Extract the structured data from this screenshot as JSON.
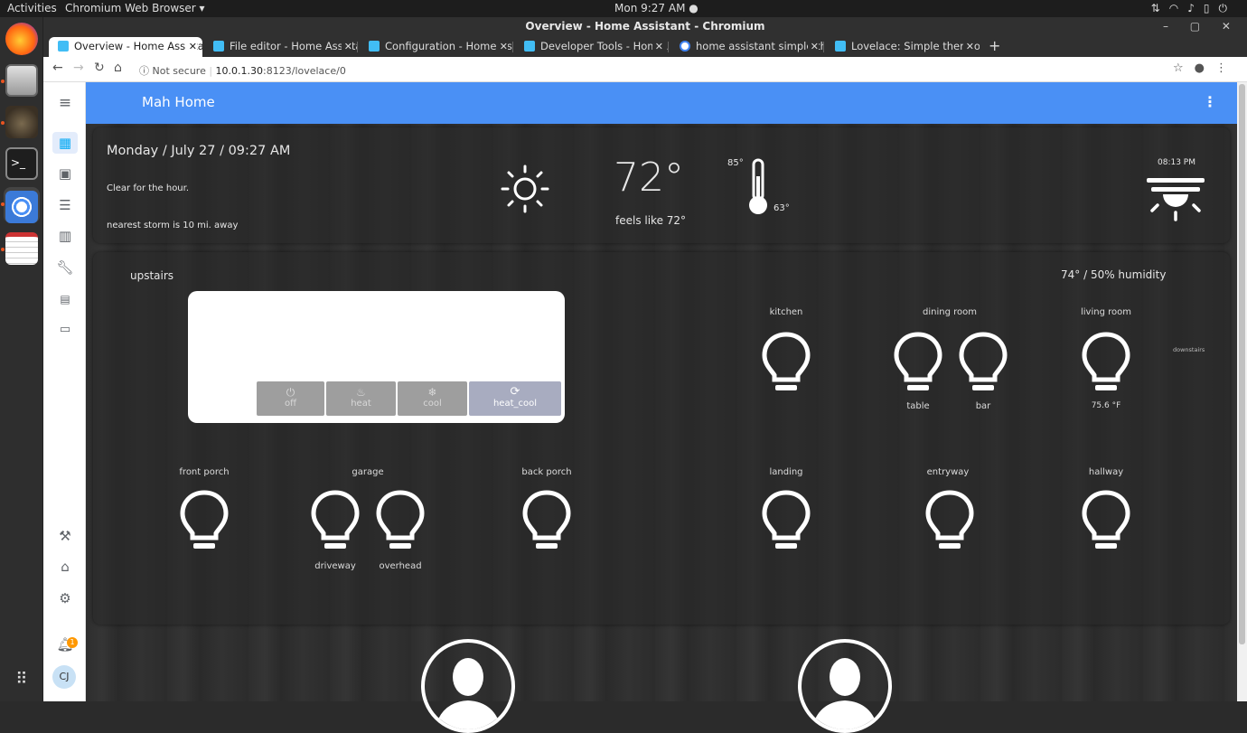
{
  "os": {
    "activities": "Activities",
    "app_menu": "Chromium Web Browser ▾",
    "clock": "Mon  9:27 AM ●",
    "tray_icons": [
      "network-icon",
      "wifi-icon",
      "volume-icon",
      "battery-icon",
      "power-icon"
    ]
  },
  "window": {
    "title": "Overview - Home Assistant - Chromium",
    "controls": "– ▢ ✕"
  },
  "tabs": [
    {
      "label": "Overview - Home Assistan",
      "active": true
    },
    {
      "label": "File editor - Home Assista",
      "active": false
    },
    {
      "label": "Configuration - Home Ass",
      "active": false
    },
    {
      "label": "Developer Tools - Home A",
      "active": false
    },
    {
      "label": "home assistant simple the",
      "active": false
    },
    {
      "label": "Lovelace: Simple thermos",
      "active": false
    }
  ],
  "address": {
    "security": "Not secure",
    "host": "10.0.1.30",
    "path": ":8123/lovelace/0"
  },
  "sidebar": {
    "avatar_initials": "CJ",
    "notification_count": "1"
  },
  "header": {
    "title": "Mah Home"
  },
  "weather": {
    "date_time": "Monday / July 27 / 09:27 AM",
    "summary": "Clear for the hour.",
    "storm": "nearest storm is 10 mi. away",
    "temperature": "72°",
    "feels_like": "feels like 72°",
    "high": "85°",
    "low": "63°",
    "sunset_time": "08:13 PM"
  },
  "upstairs": {
    "title": "upstairs",
    "climate": "74° / 50% humidity",
    "modes": [
      {
        "label": "off",
        "icon": "power-icon",
        "selected": false
      },
      {
        "label": "heat",
        "icon": "flame-icon",
        "selected": false
      },
      {
        "label": "cool",
        "icon": "snowflake-icon",
        "selected": false
      },
      {
        "label": "heat_cool",
        "icon": "autorenew-icon",
        "selected": true
      }
    ],
    "rooms": {
      "kitchen": "kitchen",
      "dining_room": "dining room",
      "living_room": "living room",
      "table": "table",
      "bar": "bar",
      "living_temp": "75.6 °F",
      "downstairs": "downstairs"
    }
  },
  "downstairs": {
    "front_porch": "front porch",
    "garage": "garage",
    "driveway": "driveway",
    "overhead": "overhead",
    "back_porch": "back porch",
    "landing": "landing",
    "entryway": "entryway",
    "hallway": "hallway"
  }
}
